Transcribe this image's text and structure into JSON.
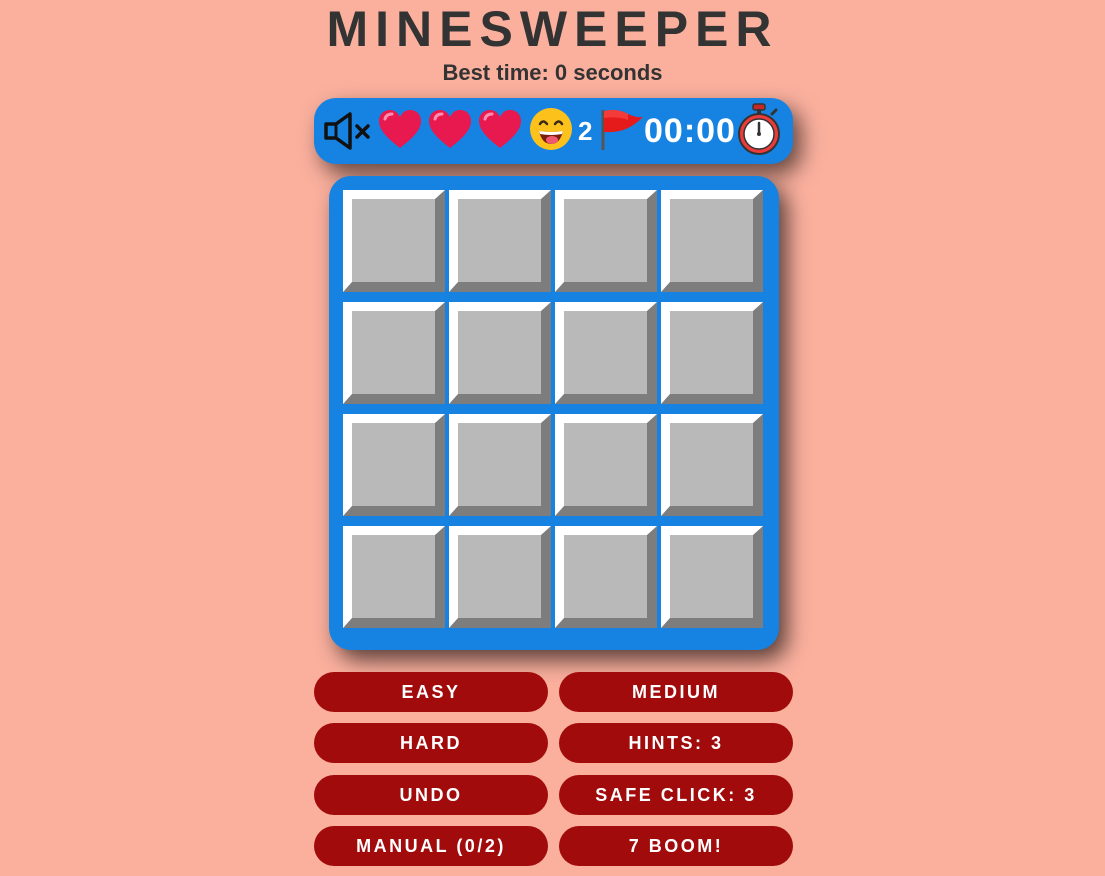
{
  "header": {
    "title": "MINESWEEPER",
    "best_time": "Best time: 0 seconds"
  },
  "status": {
    "sound_icon": "speaker-muted-icon",
    "lives": 3,
    "heart_icon": "heart-icon",
    "face_icon": "smiley-tongue-icon",
    "flags_remaining": "2",
    "flag_icon": "red-flag-icon",
    "timer": "00:00",
    "timer_icon": "stopwatch-icon"
  },
  "board": {
    "rows": 4,
    "cols": 4
  },
  "buttons": {
    "easy": "EASY",
    "medium": "MEDIUM",
    "hard": "HARD",
    "hints": "HINTS: 3",
    "undo": "UNDO",
    "safe_click": "SAFE CLICK: 3",
    "manual": "MANUAL (0/2)",
    "boom": "7 BOOM!"
  },
  "colors": {
    "background": "#fbb09e",
    "panel": "#1683e3",
    "button": "#a10b0b",
    "cell": "#b9b9b9",
    "text": "#333333"
  }
}
